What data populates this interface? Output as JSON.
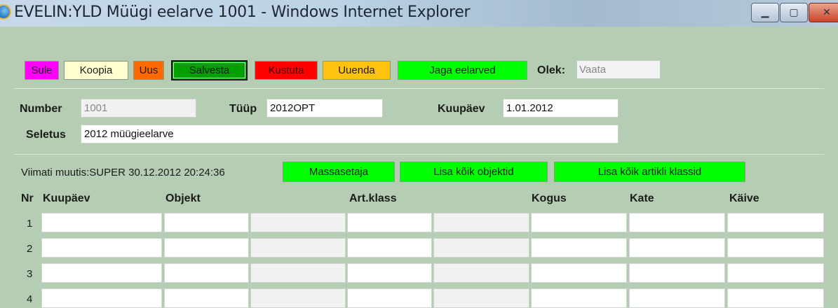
{
  "window": {
    "title": "EVELIN:YLD Müügi eelarve 1001 - Windows Internet Explorer"
  },
  "toolbar": {
    "buttons": [
      {
        "label": "Sule"
      },
      {
        "label": "Koopia"
      },
      {
        "label": "Uus"
      },
      {
        "label": "Salvesta"
      },
      {
        "label": "Kustuta"
      },
      {
        "label": "Uuenda"
      },
      {
        "label": "Jaga eelarved"
      }
    ],
    "olek_label": "Olek:",
    "olek_value": "Vaata"
  },
  "form": {
    "number_label": "Number",
    "number_value": "1001",
    "tyyp_label": "Tüüp",
    "tyyp_value": "2012OPT",
    "kuupaev_label": "Kuupäev",
    "kuupaev_value": "1.01.2012",
    "seletus_label": "Seletus",
    "seletus_value": "2012 müügieelarve"
  },
  "info": {
    "modified_text": "Viimati muutis:SUPER 30.12.2012 20:24:36",
    "buttons": [
      "Massasetaja",
      "Lisa kõik objektid",
      "Lisa kõik artikli klassid"
    ]
  },
  "grid": {
    "columns": [
      "Nr",
      "Kuupäev",
      "Objekt",
      "Art.klass",
      "Kogus",
      "Kate",
      "Käive"
    ],
    "rows": [
      "1",
      "2",
      "3",
      "4"
    ]
  }
}
